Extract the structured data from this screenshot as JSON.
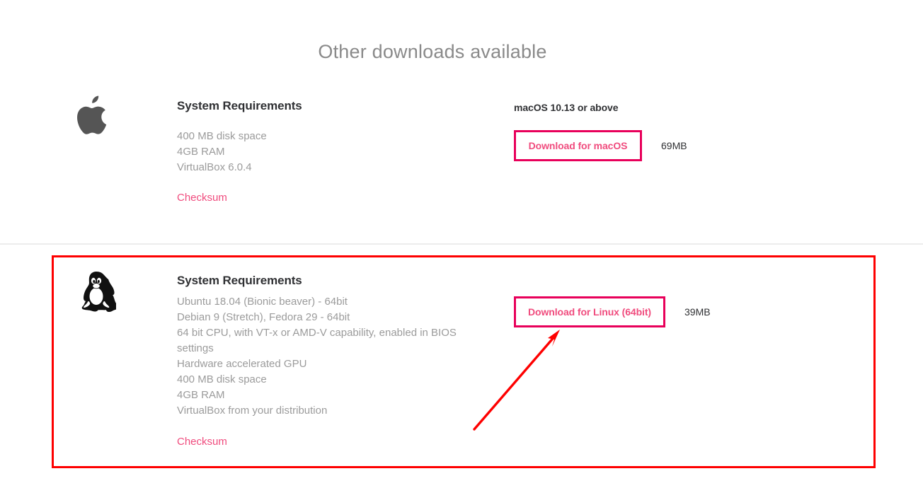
{
  "page": {
    "title": "Other downloads available"
  },
  "sections": [
    {
      "id": "macos",
      "icon": "apple-logo-icon",
      "requirements_title": "System Requirements",
      "requirements": [
        "400 MB disk space",
        "4GB RAM",
        "VirtualBox 6.0.4"
      ],
      "checksum_label": "Checksum",
      "os_version": "macOS 10.13 or above",
      "download_label": "Download for macOS",
      "download_size": "69MB"
    },
    {
      "id": "linux",
      "icon": "linux-tux-penguin-icon",
      "requirements_title": "System Requirements",
      "requirements": [
        "Ubuntu 18.04 (Bionic beaver) - 64bit",
        "Debian 9 (Stretch), Fedora 29 - 64bit",
        "64 bit CPU, with VT-x or AMD-V capability, enabled in BIOS settings",
        "Hardware accelerated GPU",
        "400 MB disk space",
        "4GB RAM",
        "VirtualBox from your distribution"
      ],
      "checksum_label": "Checksum",
      "os_version": "",
      "download_label": "Download for Linux (64bit)",
      "download_size": "39MB"
    }
  ],
  "annotations": {
    "highlight_box_color": "#fe0000",
    "arrow_color": "#fe0000",
    "arrow_target": "Download for Linux (64bit)"
  },
  "colors": {
    "accent_pink": "#f04c7e",
    "button_border": "#e8005a",
    "title_gray": "#8a8a8a",
    "body_gray": "#9b9b9b",
    "heading_dark": "#2f3033"
  }
}
